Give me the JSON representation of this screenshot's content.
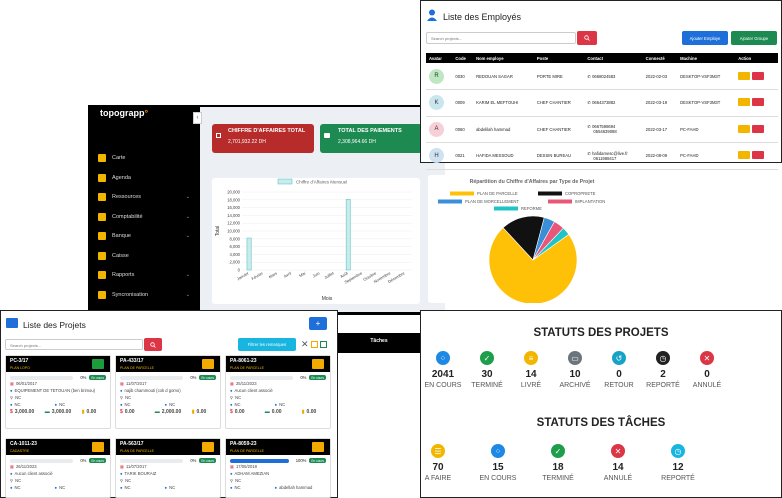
{
  "sidebar": {
    "logo": "topograpp",
    "items": [
      {
        "label": "Carte",
        "chevron": false
      },
      {
        "label": "Agenda",
        "chevron": false
      },
      {
        "label": "Ressources",
        "chevron": true
      },
      {
        "label": "Comptabilité",
        "chevron": true
      },
      {
        "label": "Banque",
        "chevron": true
      },
      {
        "label": "Caisse",
        "chevron": false
      },
      {
        "label": "Rapports",
        "chevron": true
      },
      {
        "label": "Syncronisation",
        "chevron": true
      }
    ]
  },
  "cards": {
    "ca": {
      "title": "CHIFFRE D'AFFAIRES TOTAL",
      "value": "2,701,932.22 DH",
      "color": "#b72b2b"
    },
    "paie": {
      "title": "TOTAL DES PAIEMENTS",
      "value": "2,308,964.66 DH",
      "color": "#1d8a52"
    }
  },
  "chart_data": [
    {
      "type": "bar",
      "legend": "Chiffre d'Affaires Mensuel",
      "categories": [
        "Janvier",
        "Février",
        "Mars",
        "Avril",
        "Mai",
        "Juin",
        "Juillet",
        "Août",
        "Septembre",
        "Octobre",
        "Novembre",
        "Décembre"
      ],
      "values": [
        8200,
        0,
        0,
        0,
        0,
        0,
        0,
        18100,
        0,
        0,
        0,
        0
      ],
      "yticks": [
        "0",
        "2,000",
        "4,000",
        "6,000",
        "8,000",
        "10,000",
        "12,000",
        "14,000",
        "16,000",
        "18,000",
        "20,000"
      ],
      "ylim": [
        0,
        20000
      ],
      "ylabel": "Total",
      "xlabel": "Mois"
    },
    {
      "type": "pie",
      "title": "Répartition du Chiffre d'Affaires par Type de Projet",
      "labels": [
        "PLAN DE PARCELLE",
        "COPROPRIETE",
        "PLAN DE MORCELLEMENT",
        "IMPLANTATION",
        "REFORME"
      ],
      "colors": [
        "#ffc107",
        "#111111",
        "#3b8fd9",
        "#e8577a",
        "#20c4c4"
      ],
      "values": [
        73,
        16,
        4,
        4,
        3
      ]
    }
  ],
  "employees": {
    "title": "Liste des Employés",
    "search_placeholder": "Search projects...",
    "add_employee": "Ajouter Employe",
    "add_group": "Ajouter Groupe",
    "headers": [
      "Avatar",
      "Code",
      "Nom employe",
      "Poste",
      "Contact",
      "Connecté",
      "Machine",
      "Action"
    ],
    "rows": [
      {
        "initial": "R",
        "avatar_color": "#bde8c2",
        "code": "0030",
        "name": "REDOUAN SAGAR",
        "poste": "PORTE MIRE",
        "contact": "0668024583",
        "contact2": "",
        "date": "2022-02-03",
        "machine": "DESKTOP-VSF3M3T"
      },
      {
        "initial": "K",
        "avatar_color": "#c9e6ef",
        "code": "0009",
        "name": "KARIM EL MEFTOUHI",
        "poste": "CHEF CHANTIER",
        "contact": "0664373882",
        "contact2": "",
        "date": "2022-03-19",
        "machine": "DESKTOP-VSF3M3T"
      },
      {
        "initial": "A",
        "avatar_color": "#f7cfd6",
        "code": "0060",
        "name": "abdelilah hammad",
        "poste": "CHEF CHANTIER",
        "contact": "0667598694",
        "contact2": "0554639088",
        "date": "2022-03-17",
        "machine": "PC-FAHD"
      },
      {
        "initial": "H",
        "avatar_color": "#cfe2f2",
        "code": "0021",
        "name": "HAFIDA MESSOUD",
        "poste": "DESSIN BUREAU",
        "contact": "hafidamesc@live.fr",
        "contact2": "0611988417",
        "date": "2022-08-09",
        "machine": "PC-FAHD"
      }
    ]
  },
  "projects": {
    "title": "Liste des Projets",
    "search_placeholder": "Search projects...",
    "filter": "Filtrer les remarques",
    "add": "+",
    "items": [
      {
        "code": "PC-3/17",
        "type": "PLAN LOPO",
        "pct": "0%",
        "status": "En cours",
        "date": "06/01/2017",
        "client": "EQUIPEMENT DE TETOUAN (ben brimou)",
        "a": "NC",
        "b": "NC",
        "c": "NC",
        "m1": "3,000.00",
        "m2": "3,000.00",
        "m3": "0.00",
        "fold": "#1d9c3c",
        "fill": 0
      },
      {
        "code": "PA-433/17",
        "type": "PLAN DE PARCELLE",
        "pct": "0%",
        "status": "En cours",
        "date": "11/07/2017",
        "client": "najib chammouti (cok d gomo)",
        "a": "NC",
        "b": "NC",
        "c": "NC",
        "m1": "0.00",
        "m2": "2,000.00",
        "m3": "0.00",
        "fold": "#f2a900",
        "fill": 0
      },
      {
        "code": "PA-8061-23",
        "type": "PLAN DE PARCELLE",
        "pct": "0%",
        "status": "En cours",
        "date": "25/11/2023",
        "client": "Aucun client associé",
        "a": "NC",
        "b": "NC",
        "c": "NC",
        "m1": "0.00",
        "m2": "0.00",
        "m3": "0.00",
        "fold": "#f2a900",
        "fill": 0
      },
      {
        "code": "CA-1011-23",
        "type": "CADASTRE",
        "pct": "0%",
        "status": "En cours",
        "date": "26/11/2023",
        "client": "Aucun client associé",
        "a": "NC",
        "b": "NC",
        "c": "NC",
        "fold": "#f2a900",
        "fill": 0
      },
      {
        "code": "PA-563/17",
        "type": "PLAN DE PARCELLE",
        "pct": "0%",
        "status": "En cours",
        "date": "11/07/2017",
        "client": "TARIK BOURAIZ",
        "a": "NC",
        "b": "NC",
        "c": "NC",
        "fold": "#f2a900",
        "fill": 0
      },
      {
        "code": "PA-8059-23",
        "type": "PLAN DE PARCELLE",
        "pct": "100%",
        "status": "En cours",
        "date": "17/05/2018",
        "client": "ADHAM AMEZIAN",
        "a": "NC",
        "b": "NC",
        "c": "abdellah hammad",
        "fold": "#f2a900",
        "fill": 1
      }
    ]
  },
  "taches_label": "Tâches",
  "statuts": {
    "projets_title": "STATUTS DES PROJETS",
    "projets": [
      {
        "n": "2041",
        "l": "EN COURS",
        "c": "#1e88e5",
        "icon": "spinner-icon"
      },
      {
        "n": "30",
        "l": "TERMINÉ",
        "c": "#1e9e4a",
        "icon": "check-icon"
      },
      {
        "n": "14",
        "l": "LIVRÉ",
        "c": "#f2b600",
        "icon": "document-icon"
      },
      {
        "n": "10",
        "l": "ARCHIVÉ",
        "c": "#6c757d",
        "icon": "archive-icon"
      },
      {
        "n": "0",
        "l": "RETOUR",
        "c": "#17a2c8",
        "icon": "undo-icon"
      },
      {
        "n": "2",
        "l": "REPORTÉ",
        "c": "#222222",
        "icon": "clock-icon"
      },
      {
        "n": "0",
        "l": "ANNULÉ",
        "c": "#dc3545",
        "icon": "times-icon"
      }
    ],
    "taches_title": "STATUTS DES TÂCHES",
    "taches": [
      {
        "n": "70",
        "l": "A FAIRE",
        "c": "#f2b600",
        "icon": "list-icon"
      },
      {
        "n": "15",
        "l": "EN COURS",
        "c": "#1e88e5",
        "icon": "spinner-icon"
      },
      {
        "n": "18",
        "l": "TERMINÉ",
        "c": "#1e9e4a",
        "icon": "check-icon"
      },
      {
        "n": "14",
        "l": "ANNULÉ",
        "c": "#dc3545",
        "icon": "times-icon"
      },
      {
        "n": "12",
        "l": "REPORTÉ",
        "c": "#17b5e0",
        "icon": "clock-icon"
      }
    ]
  }
}
